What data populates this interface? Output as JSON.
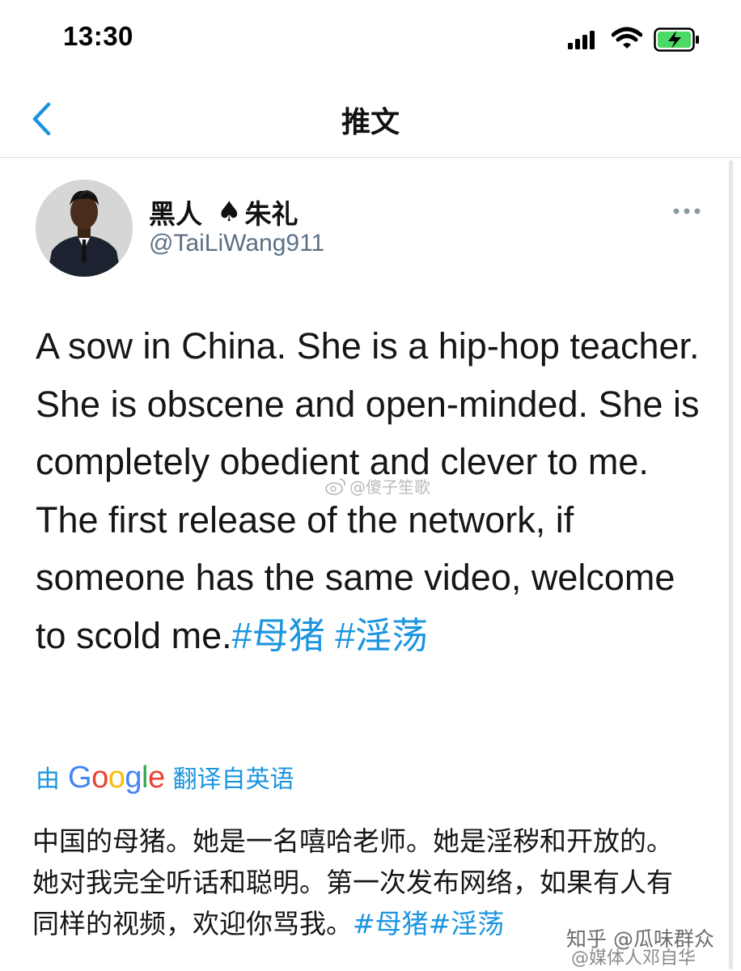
{
  "status_bar": {
    "time": "13:30",
    "icons": [
      "signal-icon",
      "wifi-icon",
      "battery-charging-icon"
    ],
    "battery_color": "#4cd964"
  },
  "nav": {
    "title": "推文",
    "back_icon": "chevron-left-icon",
    "accent_color": "#1b95e0"
  },
  "tweet": {
    "display_name_part1": "黑人",
    "display_name_symbol": "♠",
    "display_name_part2": "朱礼",
    "handle": "@TaiLiWang911",
    "more_icon": "more-horizontal-icon",
    "text": "A sow in China. She is a hip-hop teacher. She is obscene and open-minded. She is completely obedient and clever to me. The first release of the network, if someone has the same video, welcome to scold me.",
    "hashtag1": "#母猪",
    "hashtag2": "#淫荡",
    "hashtag_color": "#1b95e0"
  },
  "translation": {
    "prefix": "由",
    "provider": "Google",
    "suffix": "翻译自英语",
    "text": "中国的母猪。她是一名嘻哈老师。她是淫秽和开放的。她对我完全听话和聪明。第一次发布网络，如果有人有同样的视频，欢迎你骂我。",
    "hashtags": "#母猪#淫荡"
  },
  "watermarks": {
    "center": "@傻子笙歌",
    "bottom_line1": "知乎 @瓜味群众",
    "bottom_line2": "@媒体人邓自华"
  }
}
